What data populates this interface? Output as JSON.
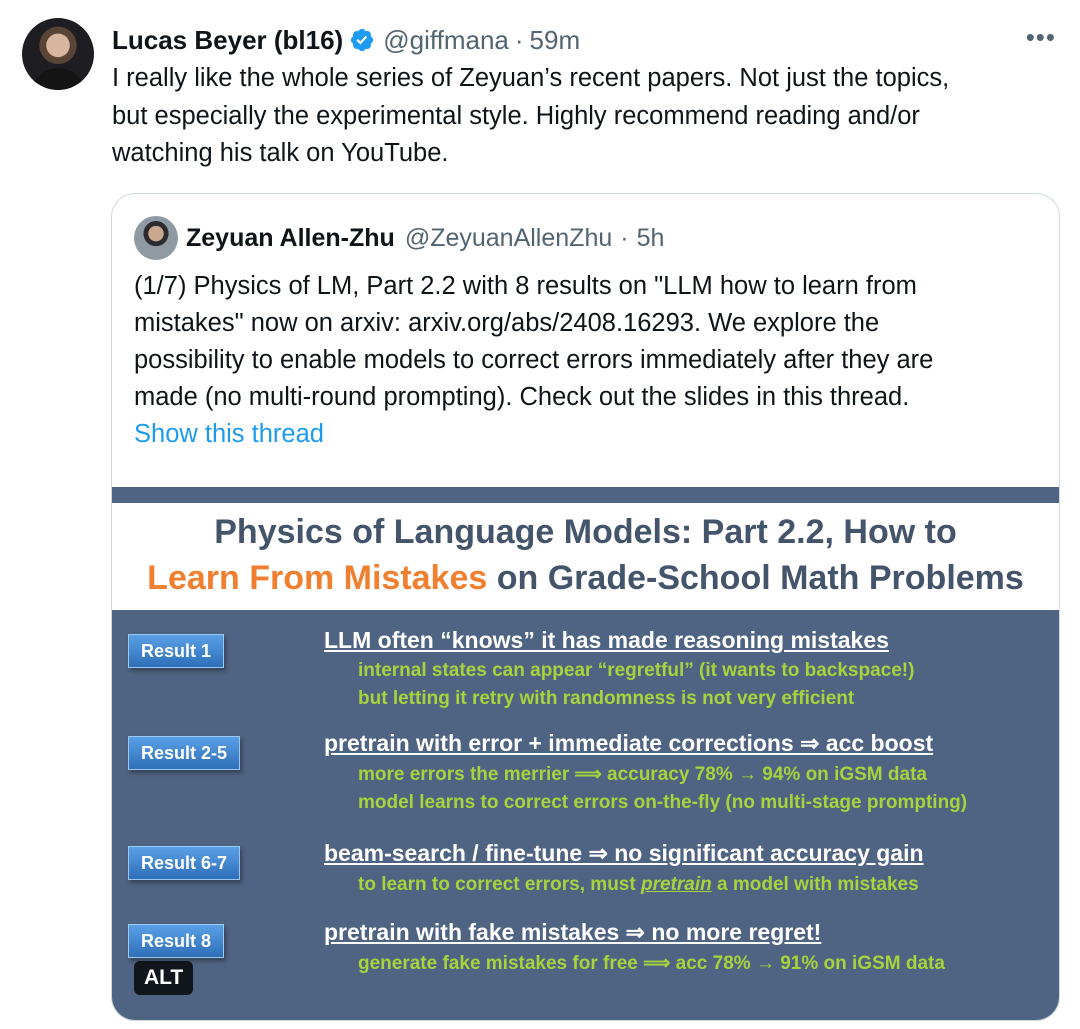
{
  "tweet": {
    "author_name": "Lucas Beyer (bl16)",
    "handle": "@giffmana",
    "separator": "·",
    "time": "59m",
    "more_icon": "more-icon",
    "verified_color": "#1d9bf0",
    "text_lines": [
      "I really like the whole series of Zeyuan’s recent papers. Not just the topics,",
      "but especially the experimental style. Highly recommend reading and/or",
      "watching his talk on YouTube."
    ]
  },
  "quoted": {
    "author_name": "Zeyuan Allen-Zhu",
    "handle": "@ZeyuanAllenZhu",
    "separator": "·",
    "time": "5h",
    "text_lines": [
      "(1/7) Physics of LM, Part 2.2 with 8 results on \"LLM how to learn from",
      "mistakes\" now on arxiv: arxiv.org/abs/2408.16293. We explore the",
      "possibility to enable models to correct errors immediately after they are",
      "made (no multi-round prompting). Check out the slides in this thread."
    ],
    "show_thread": "Show this thread",
    "link_color": "#1d9bf0"
  },
  "slide": {
    "title_line1": "Physics of Language Models: Part 2.2, How to",
    "title_highlight": "Learn From Mistakes",
    "title_line2_rest": " on Grade-School Math Problems",
    "colors": {
      "background": "#4f6482",
      "title": "#44546a",
      "highlight": "#f08030",
      "sub": "#a5d43c"
    },
    "results": [
      {
        "badge": "Result 1",
        "head": "LLM often “knows” it has made reasoning mistakes",
        "subs": [
          "internal states can appear “regretful” (it wants to backspace!)",
          "but letting it retry with randomness is not very efficient"
        ]
      },
      {
        "badge": "Result 2-5",
        "head": "pretrain with error + immediate corrections ⇒ acc boost",
        "subs": [
          "more errors the merrier ⟹ accuracy 78% → 94% on iGSM data",
          "model learns to correct errors on-the-fly (no multi-stage prompting)"
        ]
      },
      {
        "badge": "Result 6-7",
        "head": "beam-search / fine-tune ⇒ no significant accuracy gain",
        "subs_prefix": "to learn to correct errors, must ",
        "subs_em": "pretrain",
        "subs_suffix": " a model with mistakes"
      },
      {
        "badge": "Result 8",
        "head": "pretrain with fake mistakes ⇒ no more regret!",
        "subs": [
          "generate fake mistakes for free ⟹ acc 78% → 91% on iGSM data"
        ]
      }
    ],
    "alt_badge": "ALT"
  }
}
